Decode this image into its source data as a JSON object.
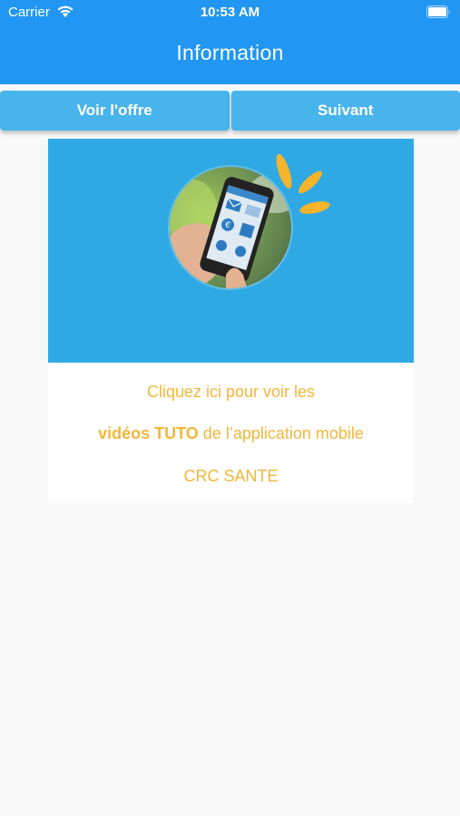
{
  "status_bar": {
    "carrier": "Carrier",
    "time": "10:53 AM"
  },
  "header": {
    "title": "Information"
  },
  "buttons": {
    "offer_label": "Voir l'offre",
    "next_label": "Suivant"
  },
  "promo": {
    "line1": "Cliquez ici pour voir les",
    "line2_bold": "vidéos TUTO",
    "line2_rest": " de l’application mobile",
    "line3": "CRC SANTE"
  },
  "icons": [
    "wifi-icon",
    "battery-icon",
    "phone-illustration",
    "sun-rays-icon",
    "mail-icon",
    "euro-icon",
    "document-icon",
    "location-icon",
    "at-icon"
  ],
  "colors": {
    "header": "#2196f3",
    "button": "#48b4ec",
    "banner": "#2fa9e3",
    "promo_text": "#f3b63a",
    "background": "#f8f8f8"
  }
}
